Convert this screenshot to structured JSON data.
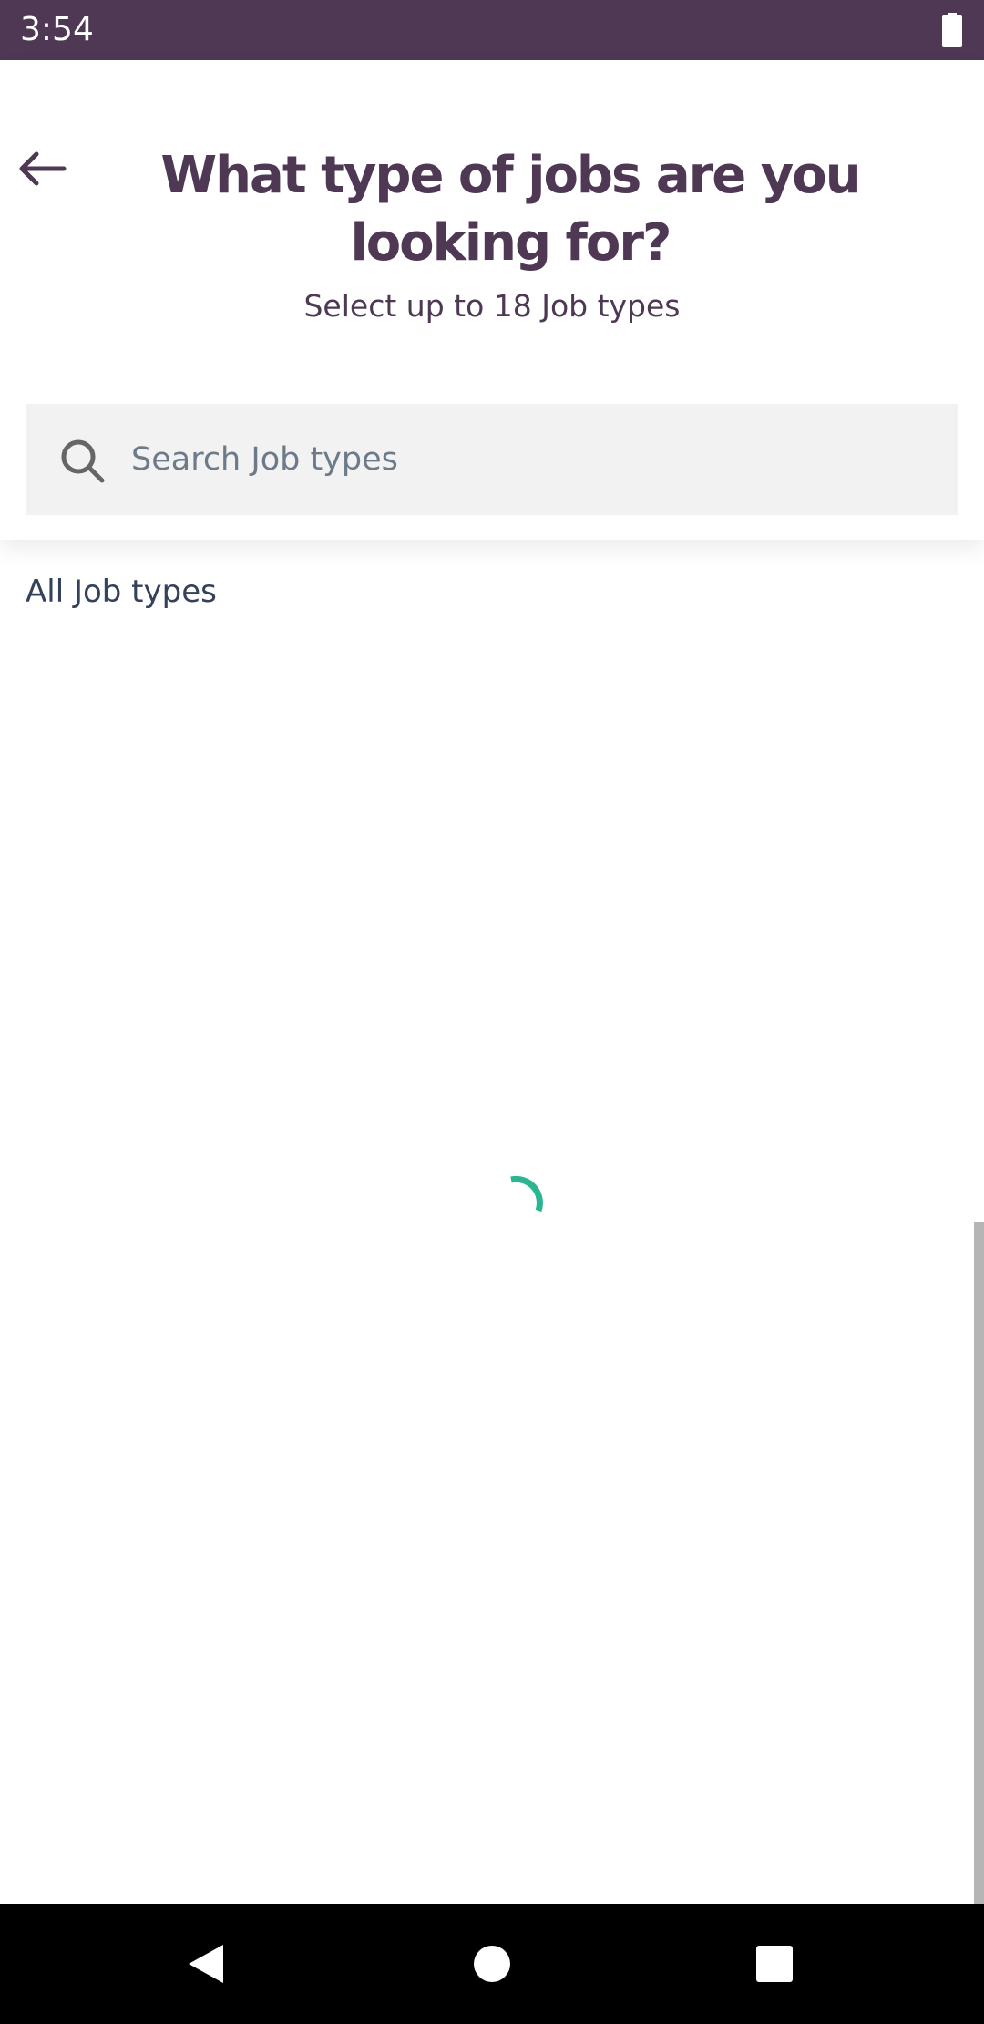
{
  "status_bar": {
    "time": "3:54",
    "icons": [
      "battery-icon"
    ]
  },
  "header": {
    "back_icon": "arrow-left-icon",
    "title": "What type of jobs are you looking for?",
    "subtitle": "Select up to 18 Job types",
    "search": {
      "placeholder": "Search Job types",
      "value": "",
      "icon": "search-icon"
    }
  },
  "list": {
    "section_title": "All Job types",
    "loading": true
  },
  "nav_bar": {
    "buttons": [
      "back-triangle-icon",
      "home-circle-icon",
      "recents-square-icon"
    ]
  },
  "colors": {
    "brand": "#4e3853",
    "spinner": "#2bb592",
    "search_bg": "#f2f2f2",
    "placeholder": "#6c7a8a"
  }
}
